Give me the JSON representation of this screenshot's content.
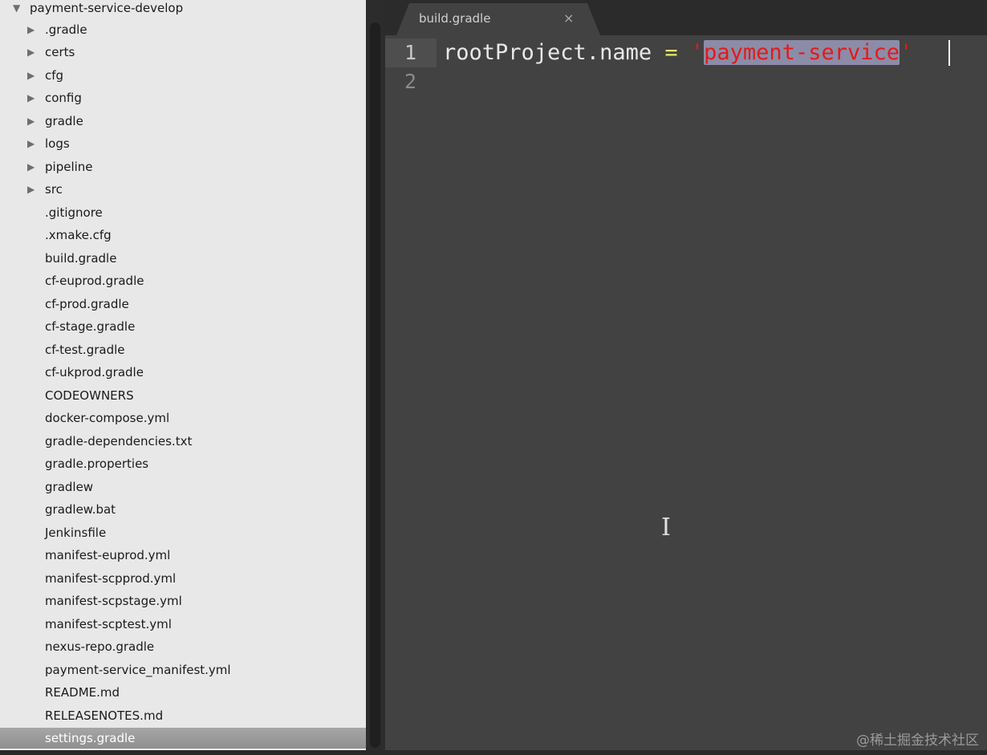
{
  "sidebar": {
    "root": "payment-service-develop",
    "folders": [
      ".gradle",
      "certs",
      "cfg",
      "config",
      "gradle",
      "logs",
      "pipeline",
      "src"
    ],
    "files": [
      ".gitignore",
      ".xmake.cfg",
      "build.gradle",
      "cf-euprod.gradle",
      "cf-prod.gradle",
      "cf-stage.gradle",
      "cf-test.gradle",
      "cf-ukprod.gradle",
      "CODEOWNERS",
      "docker-compose.yml",
      "gradle-dependencies.txt",
      "gradle.properties",
      "gradlew",
      "gradlew.bat",
      "Jenkinsfile",
      "manifest-euprod.yml",
      "manifest-scpprod.yml",
      "manifest-scpstage.yml",
      "manifest-scptest.yml",
      "nexus-repo.gradle",
      "payment-service_manifest.yml",
      "README.md",
      "RELEASENOTES.md",
      "settings.gradle"
    ],
    "selected_file": "settings.gradle"
  },
  "editor": {
    "tab": {
      "label": "build.gradle",
      "close_icon": "×"
    },
    "line_numbers": [
      "1",
      "2"
    ],
    "code": {
      "identifier": "rootProject.name",
      "operator": "=",
      "quote": "'",
      "string_value": "payment-service"
    }
  },
  "icons": {
    "expanded": "▼",
    "collapsed": "▶",
    "text_cursor": "I"
  },
  "watermark": "@稀土掘金技术社区",
  "colors": {
    "sidebar_bg": "#e8e8e8",
    "editor_bg": "#424242",
    "string": "#e01b1b",
    "selection": "#8c8ca8"
  }
}
